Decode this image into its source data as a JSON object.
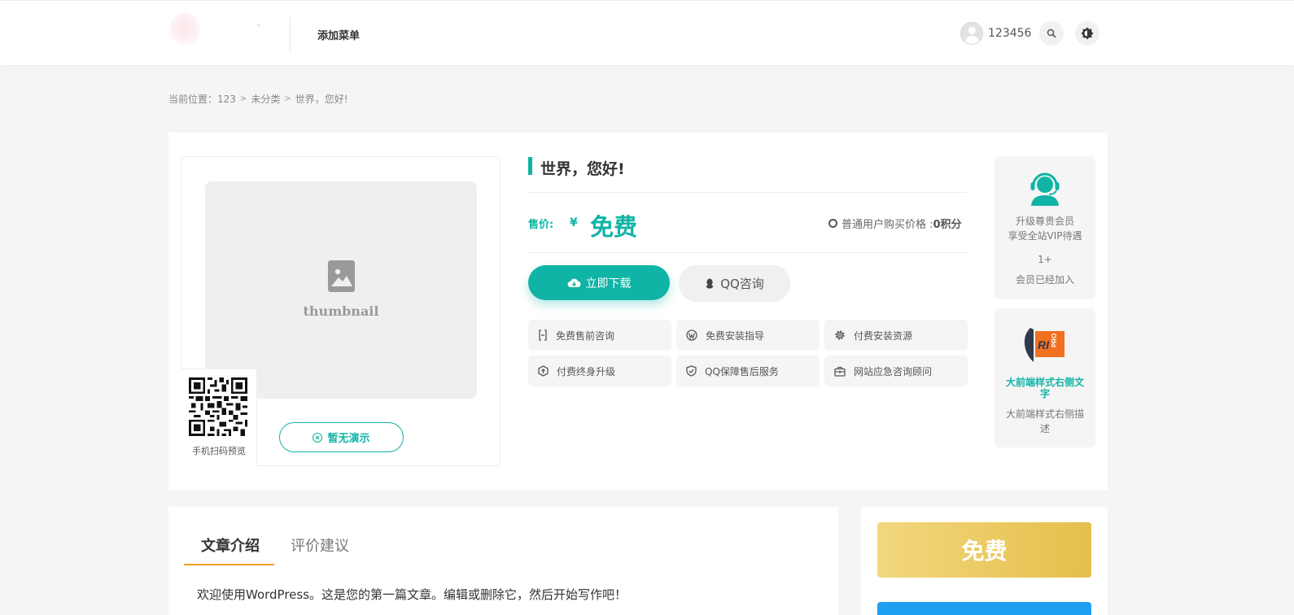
{
  "header": {
    "nav_label": "添加菜单",
    "username": "123456"
  },
  "breadcrumb": {
    "prefix": "当前位置：",
    "items": [
      "123",
      "未分类",
      "世界，您好!"
    ]
  },
  "product": {
    "title": "世界，您好!",
    "thumbnail_text": "thumbnail",
    "qr_label": "手机扫码预览",
    "demo_button": "暂无演示",
    "price_label": "售价:",
    "currency": "¥",
    "price_value": "免费",
    "member_price_text": "普通用户购买价格 :",
    "member_price_value": "0积分",
    "download_button": "立即下载",
    "qq_button": "QQ咨询",
    "services": [
      {
        "label": "免费售前咨询",
        "icon": "bracket-icon"
      },
      {
        "label": "免费安装指导",
        "icon": "wordpress-icon"
      },
      {
        "label": "付费安装资源",
        "icon": "gear-icon"
      },
      {
        "label": "付费终身升级",
        "icon": "upgrade-icon"
      },
      {
        "label": "QQ保障售后服务",
        "icon": "shield-check-icon"
      },
      {
        "label": "网站应急咨询顾问",
        "icon": "toolbox-icon"
      }
    ]
  },
  "vip": {
    "line1": "升级尊贵会员",
    "line2": "享受全站VIP待遇",
    "count": "1+",
    "joined": "会员已经加入"
  },
  "ad": {
    "title": "大前端样式右侧文字",
    "description": "大前端样式右侧描述"
  },
  "content": {
    "tabs": [
      "文章介绍",
      "评价建议"
    ],
    "text": "欢迎使用WordPress。这是您的第一篇文章。编辑或删除它，然后开始写作吧！"
  },
  "side": {
    "price": "免费"
  },
  "colors": {
    "accent": "#10b4a6",
    "gold": "#e5bf4c",
    "tab_underline": "#f0a020"
  }
}
